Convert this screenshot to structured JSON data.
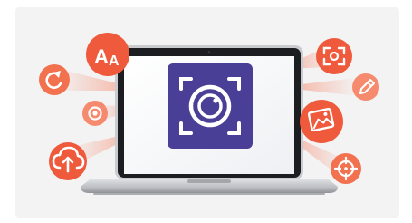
{
  "hero": {
    "app_icon": "camera-capture-icon",
    "device": "laptop",
    "feature_badges": [
      {
        "icon": "text-size-icon",
        "label": "AA",
        "color": "#ee5a3b"
      },
      {
        "icon": "rotate-icon",
        "color": "#f2714f"
      },
      {
        "icon": "radio-target-icon",
        "color": "#f58a6e"
      },
      {
        "icon": "cloud-upload-icon",
        "color": "#ee5a3b"
      },
      {
        "icon": "screenshot-frame-icon",
        "color": "#ee5a3b"
      },
      {
        "icon": "pencil-icon",
        "color": "#f58a6e"
      },
      {
        "icon": "image-edit-icon",
        "color": "#ee5a3b"
      },
      {
        "icon": "crosshair-icon",
        "color": "#f2714f"
      }
    ],
    "colors": {
      "accent": "#ee5a3b",
      "app_tile": "#4a3f96",
      "screen": "#ffffff",
      "laptop_frame": "#c9cbcf",
      "laptop_bezel": "#1c1d20",
      "background": "#f3f3f4"
    }
  }
}
